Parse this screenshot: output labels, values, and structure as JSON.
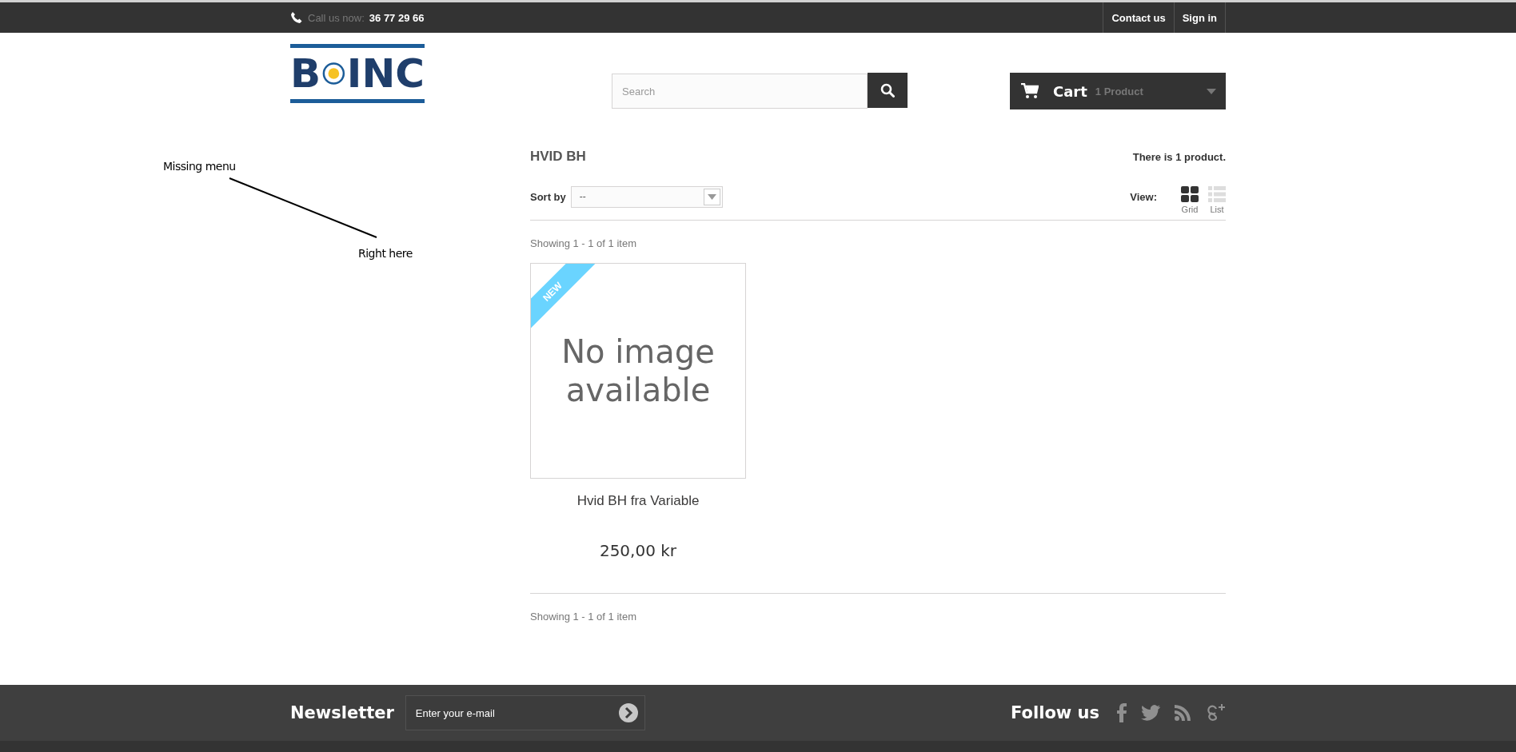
{
  "top_bar": {
    "call_label": "Call us now:",
    "phone": "36 77 29 66",
    "links": [
      "Contact us",
      "Sign in"
    ]
  },
  "logo": {
    "left": "B",
    "right": "INC"
  },
  "search": {
    "placeholder": "Search"
  },
  "cart": {
    "label": "Cart",
    "count": "1 Product"
  },
  "annotation": {
    "label": "Missing menu",
    "target": "Right here"
  },
  "category": {
    "title": "HVID BH",
    "count": "There is 1 product.",
    "sort_label": "Sort by",
    "sort_value": "--",
    "view_label": "View:",
    "views": [
      {
        "label": "Grid",
        "selected": true
      },
      {
        "label": "List",
        "selected": false
      }
    ],
    "showing_top": "Showing 1 - 1 of 1 item",
    "showing_bottom": "Showing 1 - 1 of 1 item"
  },
  "products": [
    {
      "image_text": "No image available",
      "badge": "NEW",
      "name": "Hvid BH fra Variable",
      "price": "250,00 kr"
    }
  ],
  "footer": {
    "newsletter_title": "Newsletter",
    "email_placeholder": "Enter your e-mail",
    "follow_title": "Follow us"
  }
}
